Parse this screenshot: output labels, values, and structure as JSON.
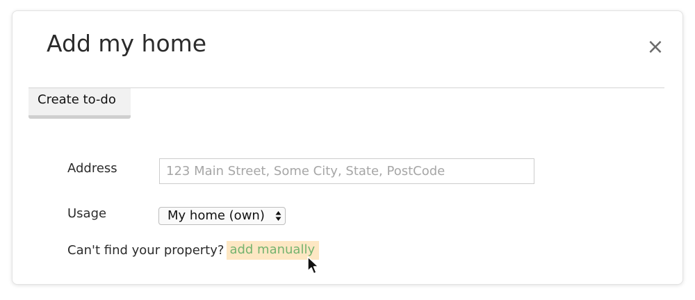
{
  "modal": {
    "title": "Add my home",
    "close_symbol": "×",
    "tab_label": "Create to-do"
  },
  "form": {
    "address": {
      "label": "Address",
      "value": "",
      "placeholder": "123 Main Street, Some City, State, PostCode"
    },
    "usage": {
      "label": "Usage",
      "selected": "My home (own)"
    },
    "cant_find_text": "Can't find your property?",
    "add_manually_link": "add manually"
  },
  "colors": {
    "link": "#74b36f",
    "link_highlight": "#fde7c3",
    "title": "#2b2b2b"
  },
  "icons": {
    "close": "close-icon",
    "select_arrows": "updown-arrows-icon",
    "cursor": "mouse-pointer-icon"
  }
}
